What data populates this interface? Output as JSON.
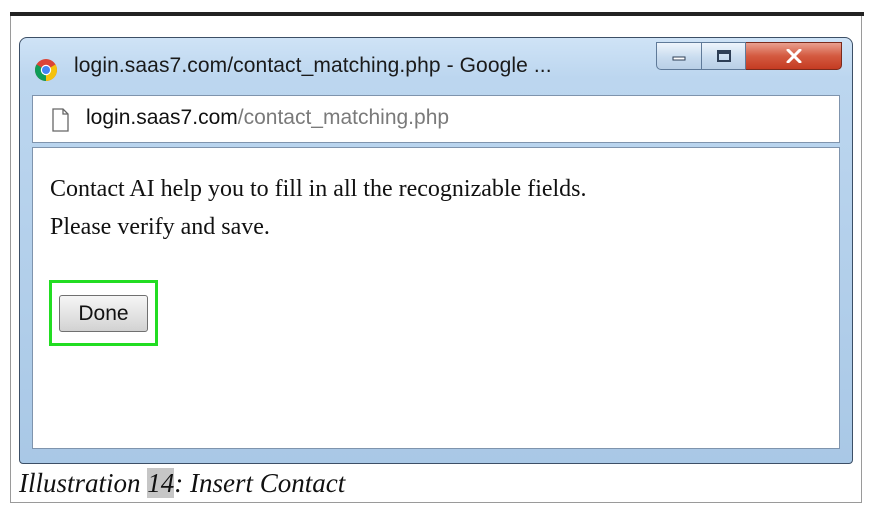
{
  "window": {
    "title": "login.saas7.com/contact_matching.php - Google ...",
    "address_host": "login.saas7.com",
    "address_path": "/contact_matching.php",
    "minimize_icon": "minimize-icon",
    "maximize_icon": "maximize-icon",
    "close_icon": "close-icon"
  },
  "dialog": {
    "message_line1": "Contact AI help you to fill in all the recognizable fields.",
    "message_line2": "Please verify and save.",
    "done_label": "Done",
    "highlight_color": "#22dd22"
  },
  "caption": {
    "prefix": "Illustration ",
    "number": "14",
    "suffix": ": Insert Contact"
  }
}
